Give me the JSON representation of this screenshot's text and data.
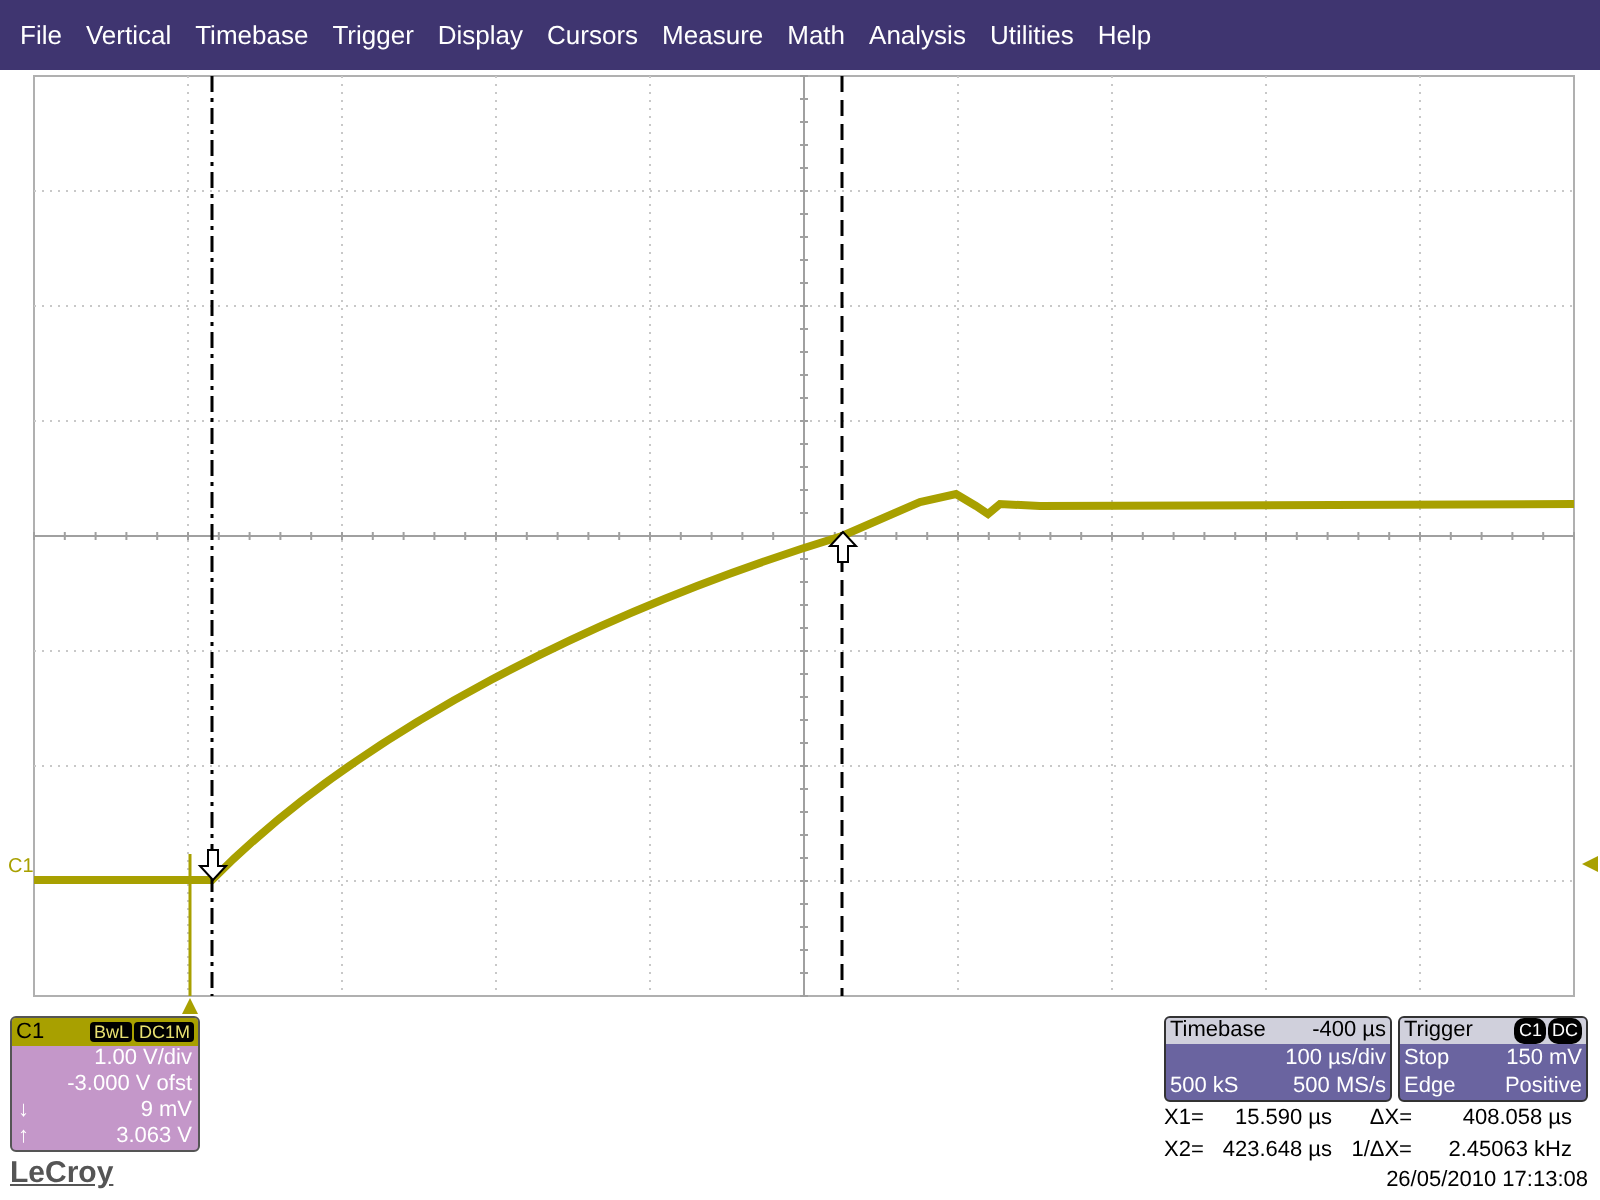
{
  "menu": [
    "File",
    "Vertical",
    "Timebase",
    "Trigger",
    "Display",
    "Cursors",
    "Measure",
    "Math",
    "Analysis",
    "Utilities",
    "Help"
  ],
  "channel_marker": "C1",
  "channel_panel": {
    "name": "C1",
    "badges": [
      "BwL",
      "DC1M"
    ],
    "scale": "1.00 V/div",
    "offset": "-3.000 V ofst",
    "rows": [
      {
        "symbol": "↓",
        "value": "9 mV"
      },
      {
        "symbol": "↑",
        "value": "3.063 V"
      }
    ]
  },
  "logo": "LeCroy",
  "timebase": {
    "title": "Timebase",
    "delay": "-400 µs",
    "per_div": "100 µs/div",
    "samples": "500 kS",
    "rate": "500 MS/s"
  },
  "trigger": {
    "title": "Trigger",
    "badges": [
      "C1",
      "DC"
    ],
    "mode": "Stop",
    "level": "150 mV",
    "type": "Edge",
    "slope": "Positive"
  },
  "readouts": [
    {
      "label": "X1=",
      "value": "15.590 µs",
      "delta_label": "ΔX=",
      "delta_value": "408.058 µs"
    },
    {
      "label": "X2=",
      "value": "423.648 µs",
      "delta_label": "1/ΔX=",
      "delta_value": "2.45063 kHz"
    }
  ],
  "timestamp": "26/05/2010 17:13:08"
}
